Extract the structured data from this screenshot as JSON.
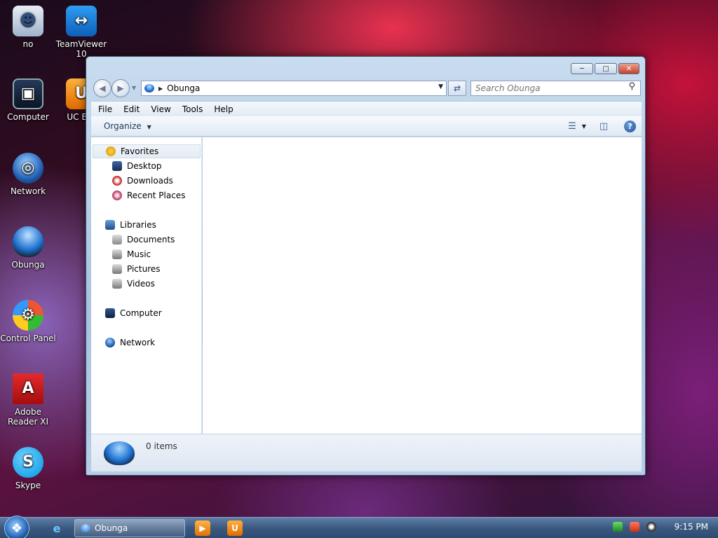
{
  "desktop": {
    "icons": [
      {
        "label": "no"
      },
      {
        "label": "TeamViewer 10"
      },
      {
        "label": "Computer"
      },
      {
        "label": "UC Bro"
      },
      {
        "label": "Network"
      },
      {
        "label": "Obunga"
      },
      {
        "label": "Control Panel"
      },
      {
        "label": "Adobe Reader XI"
      },
      {
        "label": "Skype"
      }
    ]
  },
  "window": {
    "address": {
      "location": "Obunga"
    },
    "search": {
      "placeholder": "Search Obunga"
    },
    "menu": [
      "File",
      "Edit",
      "View",
      "Tools",
      "Help"
    ],
    "toolbar": {
      "organize_label": "Organize"
    },
    "navpane": {
      "favorites": {
        "label": "Favorites",
        "items": [
          "Desktop",
          "Downloads",
          "Recent Places"
        ]
      },
      "libraries": {
        "label": "Libraries",
        "items": [
          "Documents",
          "Music",
          "Pictures",
          "Videos"
        ]
      },
      "computer": {
        "label": "Computer"
      },
      "network": {
        "label": "Network"
      }
    },
    "details": {
      "item_count": "0 items"
    }
  },
  "taskbar": {
    "active_task": {
      "label": "Obunga"
    },
    "clock": "9:15 PM"
  },
  "colors": {
    "accent_blue": "#1b6fd0",
    "close_red": "#c8402a"
  }
}
